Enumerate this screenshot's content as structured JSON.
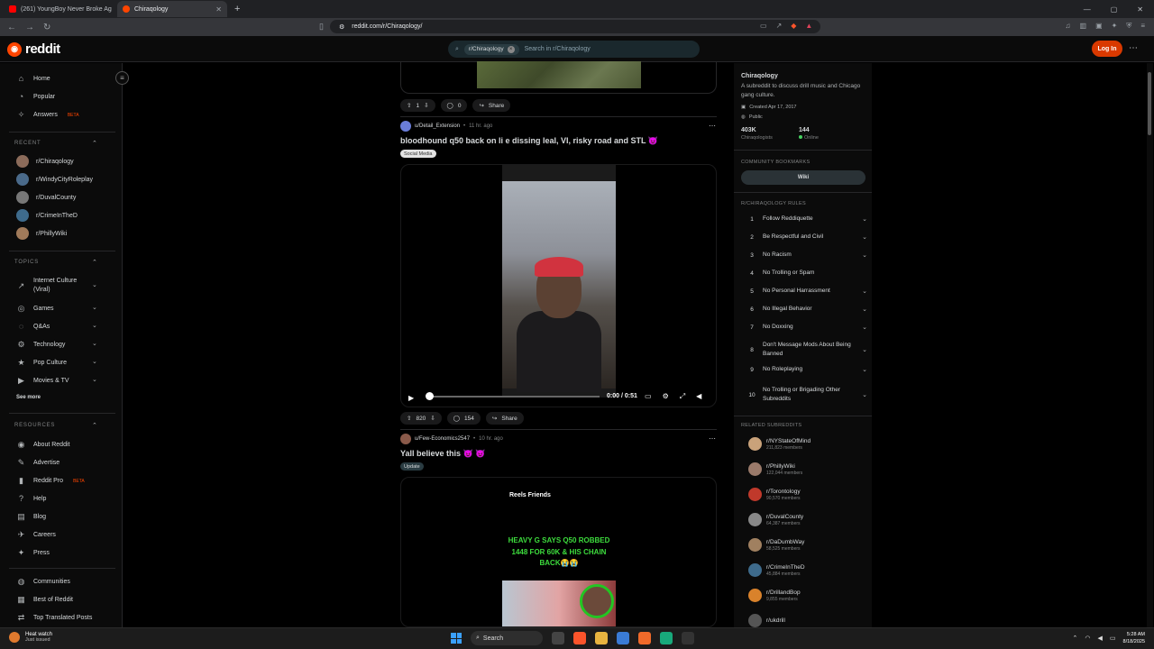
{
  "browser": {
    "tabs": [
      {
        "title": "(261) YoungBoy Never Broke Ag",
        "active": false
      },
      {
        "title": "Chiraqology",
        "active": true
      }
    ],
    "url": "reddit.com/r/Chiraqology/"
  },
  "header": {
    "logo_text": "reddit",
    "search_chip": "r/Chiraqology",
    "search_placeholder": "Search in r/Chiraqology",
    "login_label": "Log In"
  },
  "sidebar": {
    "main": [
      {
        "label": "Home",
        "icon": "home-icon"
      },
      {
        "label": "Popular",
        "icon": "popular-icon"
      },
      {
        "label": "Answers",
        "icon": "answers-icon",
        "badge": "BETA"
      }
    ],
    "recent_title": "RECENT",
    "recent": [
      "r/Chiraqology",
      "r/WindyCityRoleplay",
      "r/DuvalCounty",
      "r/CrimeInTheD",
      "r/PhillyWiki"
    ],
    "topics_title": "TOPICS",
    "topics": [
      "Internet Culture (Viral)",
      "Games",
      "Q&As",
      "Technology",
      "Pop Culture",
      "Movies & TV"
    ],
    "see_more": "See more",
    "resources_title": "RESOURCES",
    "resources": [
      {
        "label": "About Reddit"
      },
      {
        "label": "Advertise"
      },
      {
        "label": "Reddit Pro",
        "badge": "BETA"
      },
      {
        "label": "Help"
      },
      {
        "label": "Blog"
      },
      {
        "label": "Careers"
      },
      {
        "label": "Press"
      }
    ],
    "footer": [
      "Communities",
      "Best of Reddit",
      "Top Translated Posts"
    ]
  },
  "feed": {
    "prev_post_actions": {
      "votes": "1",
      "comments": "0",
      "share": "Share"
    },
    "post1": {
      "user": "u/Detail_Extension",
      "time": "11 hr. ago",
      "title": "bloodhound q50 back on li e dissing leal, VI, risky road and STL 😈",
      "flair": "Social Media",
      "video_time": "0:00 / 0:51",
      "votes": "820",
      "comments": "154",
      "share": "Share"
    },
    "post2": {
      "user": "u/Few-Economics2547",
      "time": "10 hr. ago",
      "title": "Yall believe this 😈 😈",
      "flair": "Update",
      "reel_header": "Reels  Friends",
      "reel_text": "HEAVY G SAYS Q50 ROBBED 1448 FOR 60K & HIS CHAIN BACK😭😭"
    }
  },
  "community": {
    "name": "Chiraqology",
    "description": "A subreddit to discuss drill music and Chicago gang culture.",
    "created": "Created Apr 17, 2017",
    "visibility": "Public",
    "members_count": "403K",
    "members_label": "Chiraqologists",
    "online_count": "144",
    "online_label": "Online",
    "bookmarks_title": "COMMUNITY BOOKMARKS",
    "wiki_label": "Wiki",
    "rules_title": "R/CHIRAQOLOGY RULES",
    "rules": [
      {
        "num": "1",
        "text": "Follow Reddiquette",
        "expandable": true
      },
      {
        "num": "2",
        "text": "Be Respectful and Civil",
        "expandable": true
      },
      {
        "num": "3",
        "text": "No Racism",
        "expandable": true
      },
      {
        "num": "4",
        "text": "No Trolling or Spam",
        "expandable": false
      },
      {
        "num": "5",
        "text": "No Personal Harrassment",
        "expandable": true
      },
      {
        "num": "6",
        "text": "No Illegal Behavior",
        "expandable": true
      },
      {
        "num": "7",
        "text": "No Doxxing",
        "expandable": true
      },
      {
        "num": "8",
        "text": "Don't Message Mods About Being Banned",
        "expandable": true
      },
      {
        "num": "9",
        "text": "No Roleplaying",
        "expandable": true
      },
      {
        "num": "10",
        "text": "No Trolling or Brigading Other Subreddits",
        "expandable": true
      }
    ],
    "related_title": "RELATED SUBREDDITS",
    "related": [
      {
        "name": "r/NYStateOfMind",
        "members": "211,823 members"
      },
      {
        "name": "r/PhillyWiki",
        "members": "122,044 members"
      },
      {
        "name": "r/Torontology",
        "members": "90,570 members"
      },
      {
        "name": "r/DuvalCounty",
        "members": "64,387 members"
      },
      {
        "name": "r/DaDumbWay",
        "members": "58,525 members"
      },
      {
        "name": "r/CrimeInTheD",
        "members": "45,884 members"
      },
      {
        "name": "r/DrillandBop",
        "members": "9,855 members"
      },
      {
        "name": "r/ukdrill",
        "members": ""
      }
    ]
  },
  "taskbar": {
    "weather_title": "Heat watch",
    "weather_sub": "Just issued",
    "search_label": "Search",
    "time": "5:28 AM",
    "date": "8/18/2025"
  }
}
